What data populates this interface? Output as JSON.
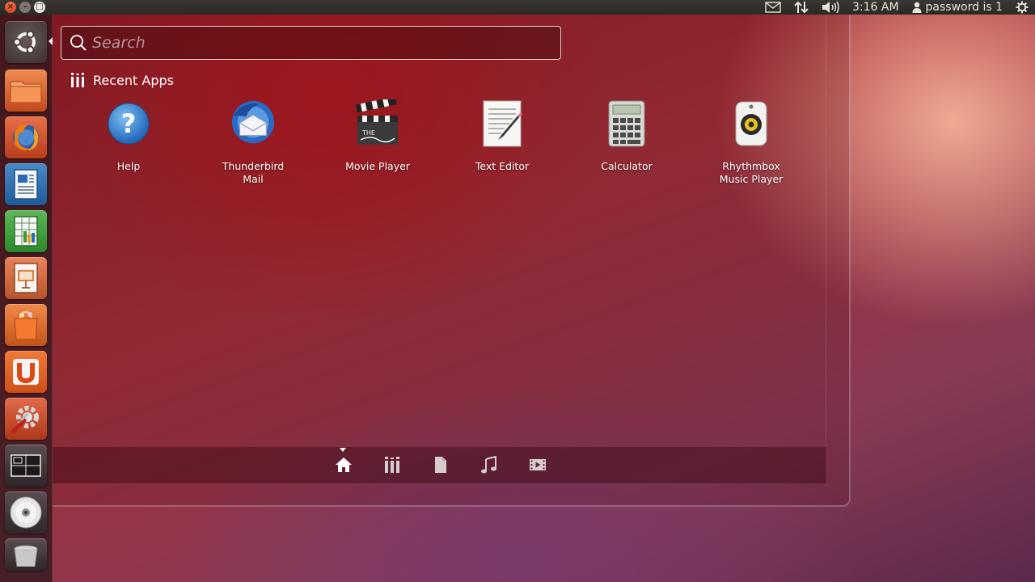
{
  "top_panel": {
    "window_buttons": [
      "close",
      "minimize",
      "maximize"
    ],
    "indicators": [
      "mail-icon",
      "network-icon",
      "volume-icon"
    ],
    "clock": "3:16 AM",
    "user_name": "password is 1",
    "session_icon": "gear-icon"
  },
  "launcher": {
    "items": [
      {
        "name": "dash-home",
        "icon": "ubuntu-logo-icon"
      },
      {
        "name": "files",
        "icon": "folder-icon"
      },
      {
        "name": "firefox",
        "icon": "firefox-icon"
      },
      {
        "name": "writer",
        "icon": "writer-icon"
      },
      {
        "name": "calc",
        "icon": "spreadsheet-icon"
      },
      {
        "name": "impress",
        "icon": "presentation-icon"
      },
      {
        "name": "software-center",
        "icon": "shopping-bag-icon"
      },
      {
        "name": "ubuntu-one",
        "icon": "ubuntu-one-icon"
      },
      {
        "name": "system-settings",
        "icon": "settings-icon"
      },
      {
        "name": "workspace-switcher",
        "icon": "workspaces-icon"
      },
      {
        "name": "cd-drive",
        "icon": "disc-icon"
      },
      {
        "name": "trash",
        "icon": "trash-icon"
      }
    ]
  },
  "search": {
    "placeholder": "Search",
    "value": ""
  },
  "recent_apps": {
    "title": "Recent Apps",
    "apps": [
      {
        "label": "Help",
        "icon": "help-icon"
      },
      {
        "label": "Thunderbird\nMail",
        "icon": "thunderbird-icon"
      },
      {
        "label": "Movie Player",
        "icon": "clapperboard-icon"
      },
      {
        "label": "Text Editor",
        "icon": "text-editor-icon"
      },
      {
        "label": "Calculator",
        "icon": "calculator-icon"
      },
      {
        "label": "Rhythmbox\nMusic Player",
        "icon": "speaker-icon"
      }
    ]
  },
  "lens_bar": {
    "lenses": [
      "home-icon",
      "apps-icon",
      "files-icon",
      "music-icon",
      "video-icon"
    ],
    "active": "home-icon"
  },
  "colors": {
    "panel": "#2b2926",
    "accent_orange": "#dd4814",
    "text": "#ffffff"
  }
}
